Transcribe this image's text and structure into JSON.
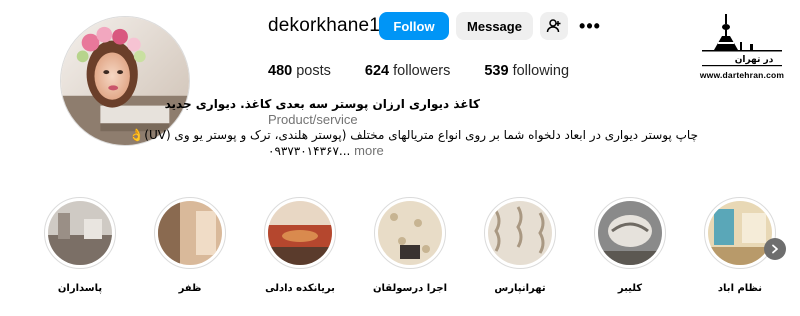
{
  "profile": {
    "username": "dekorkhane1",
    "follow_label": "Follow",
    "message_label": "Message",
    "more_label": "•••"
  },
  "stats": {
    "posts_count": "480",
    "posts_label": "posts",
    "followers_count": "624",
    "followers_label": "followers",
    "following_count": "539",
    "following_label": "following"
  },
  "bio": {
    "name": "کاغذ دیواری ارزان پوستر سه بعدی کاغذ. دیواری جدید",
    "category": "Product/service",
    "line1": "چاپ پوستر دیواری در ابعاد دلخواه شما بر روی انواع متریالهای مختلف (پوستر هلندی، ترک و پوستر یو وی (UV)👌",
    "line2": "۰۹۳۷۳۰۱۴۳۶۷...",
    "more_label": "more"
  },
  "watermark": {
    "title": "در تهران",
    "url": "www.dartehran.com"
  },
  "highlights": [
    {
      "label": "پاسداران",
      "color_a": "#cfcac4",
      "color_b": "#7b6f66"
    },
    {
      "label": "ظفر",
      "color_a": "#d9b99a",
      "color_b": "#8a6a50"
    },
    {
      "label": "بریانکده دادلی",
      "color_a": "#b5472e",
      "color_b": "#e8d7c4"
    },
    {
      "label": "اجرا درسولقان",
      "color_a": "#e8dcc7",
      "color_b": "#c7b492"
    },
    {
      "label": "تهرانپارس",
      "color_a": "#e6ded2",
      "color_b": "#a99882"
    },
    {
      "label": "کلیبر",
      "color_a": "#8a8a8a",
      "color_b": "#e6e2dc"
    },
    {
      "label": "نظام اباد",
      "color_a": "#e8d8b5",
      "color_b": "#5aa7b8"
    }
  ],
  "colors": {
    "follow_bg": "#0095f6",
    "secondary_bg": "#efefef",
    "muted_text": "#737373"
  }
}
